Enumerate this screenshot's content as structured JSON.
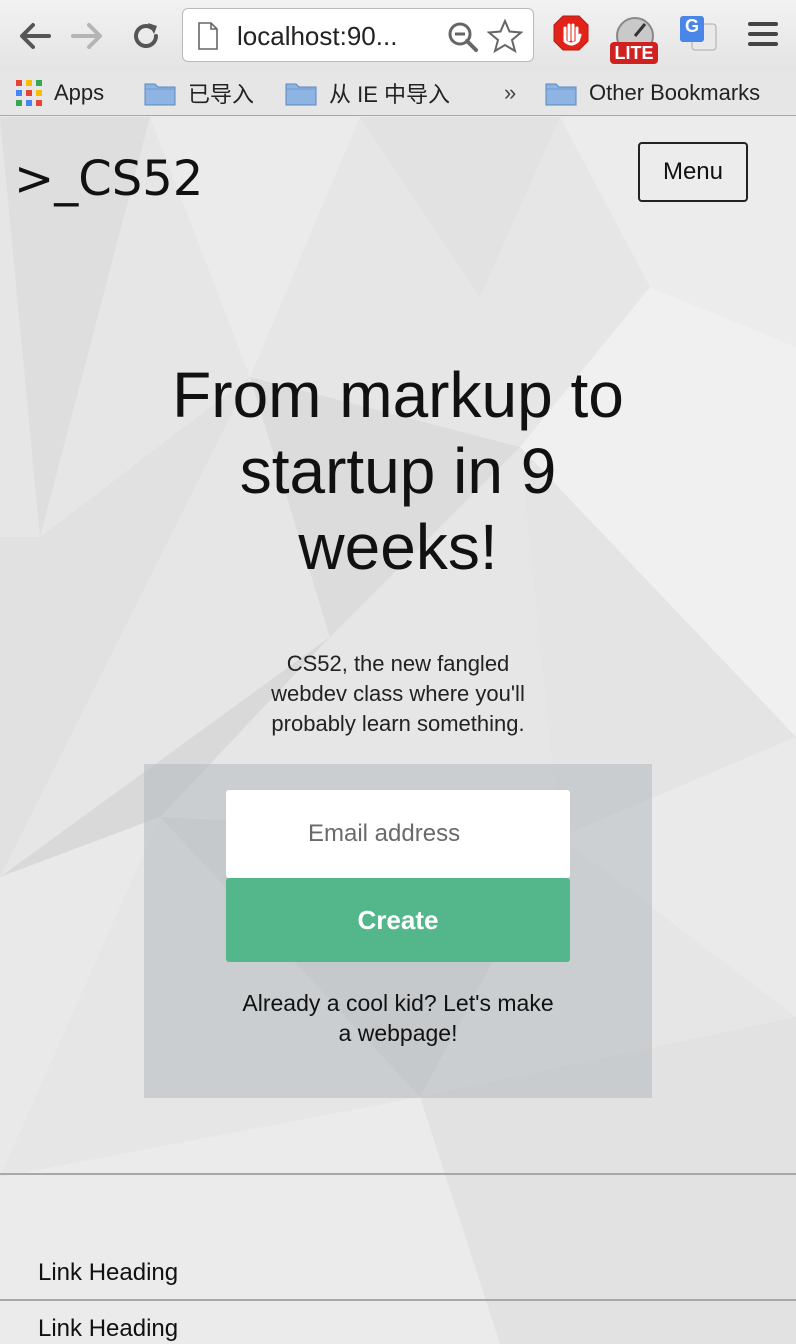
{
  "browser": {
    "url": "localhost:90...",
    "bookmarks_bar": {
      "apps_label": "Apps",
      "folders": [
        "已导入",
        "从 IE 中导入"
      ],
      "overflow": "»",
      "other_bookmarks": "Other Bookmarks"
    },
    "extensions": {
      "lite_badge": "LITE",
      "translate_glyph": "G"
    }
  },
  "page": {
    "logo": ">_CS52",
    "menu_button": "Menu",
    "hero_title_lines": [
      "From markup to",
      "startup in 9",
      "weeks!"
    ],
    "hero_subtitle_lines": [
      "CS52, the new fangled",
      "webdev class where you'll",
      "probably learn something."
    ],
    "signup": {
      "email_placeholder": "Email address",
      "create_button": "Create",
      "signin_lines": [
        "Already a cool kid? Let's make",
        "a webpage!"
      ]
    },
    "footer_links": [
      "Link Heading",
      "Link Heading"
    ]
  },
  "colors": {
    "create_button": "#54b78c",
    "page_background": "#e7e7e7",
    "stop_extension": "#e2231a",
    "lite_badge": "#d02020"
  }
}
